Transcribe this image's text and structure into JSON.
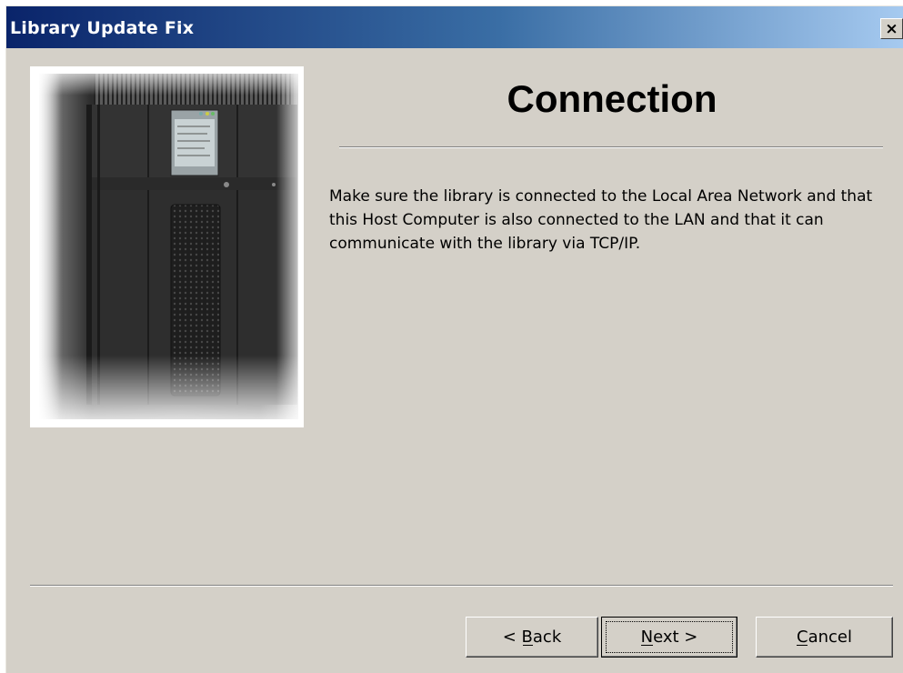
{
  "window": {
    "title": "Library Update Fix",
    "close_glyph": "×"
  },
  "picture": {
    "icon": "tape-library-image"
  },
  "page": {
    "heading": "Connection",
    "body": "Make sure the library is connected to the Local Area Network and that this Host Computer is also connected to the LAN and that it can communicate with the library via TCP/IP."
  },
  "buttons": {
    "back_label": "< Back",
    "next_label": "Next >",
    "cancel_label": "Cancel"
  },
  "colors": {
    "titlebar_start": "#0a246a",
    "titlebar_end": "#a6caf0",
    "dialog_bg": "#d4d0c8"
  }
}
